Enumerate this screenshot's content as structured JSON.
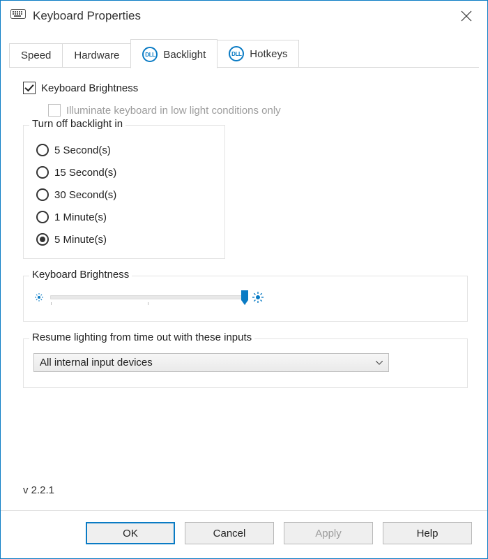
{
  "window": {
    "title": "Keyboard Properties"
  },
  "tabs": [
    {
      "label": "Speed",
      "icon": null,
      "active": false
    },
    {
      "label": "Hardware",
      "icon": null,
      "active": false
    },
    {
      "label": "Backlight",
      "icon": "dell",
      "active": true
    },
    {
      "label": "Hotkeys",
      "icon": "dell",
      "active": false
    }
  ],
  "brightness_checkbox": {
    "label": "Keyboard Brightness",
    "checked": true
  },
  "lowlight_checkbox": {
    "label": "Illuminate keyboard in low light conditions only",
    "checked": false,
    "disabled": true
  },
  "timeout_group": {
    "legend": "Turn off backlight in",
    "options": [
      {
        "label": "5 Second(s)",
        "selected": false
      },
      {
        "label": "15 Second(s)",
        "selected": false
      },
      {
        "label": "30 Second(s)",
        "selected": false
      },
      {
        "label": "1 Minute(s)",
        "selected": false
      },
      {
        "label": "5 Minute(s)",
        "selected": true
      }
    ]
  },
  "slider": {
    "legend": "Keyboard Brightness",
    "min": 0,
    "max": 100,
    "value": 100
  },
  "resume_group": {
    "legend": "Resume lighting from time out with these inputs",
    "selected": "All internal input devices"
  },
  "version": "v 2.2.1",
  "buttons": {
    "ok": "OK",
    "cancel": "Cancel",
    "apply": "Apply",
    "help": "Help"
  },
  "colors": {
    "accent": "#0a7bc4"
  }
}
